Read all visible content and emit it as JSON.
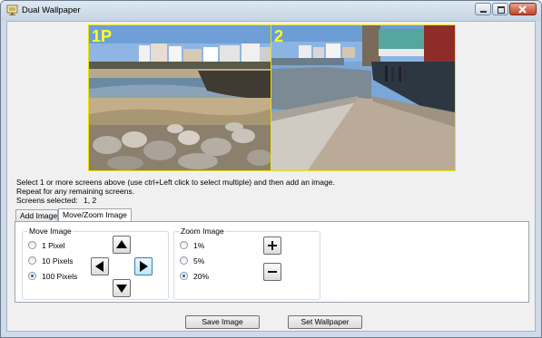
{
  "window": {
    "title": "Dual Wallpaper",
    "app_icon": "wallpaper-app-icon",
    "controls": [
      "minimize-icon",
      "maximize-icon",
      "close-icon"
    ]
  },
  "preview": {
    "screens": [
      {
        "label": "1P",
        "selected": true,
        "image": "beach-town-photo"
      },
      {
        "label": "2",
        "selected": true,
        "image": "promenade-seawall-photo"
      }
    ],
    "highlight_color": "#e8e400"
  },
  "instructions": {
    "line1": "Select 1 or more screens above (use ctrl+Left click to select multiple) and then add an image.",
    "line2": "Repeat for any remaining screens.",
    "selected_label": "Screens selected:",
    "selected_value": "1, 2"
  },
  "tabs": [
    {
      "label": "Add Image",
      "active": false
    },
    {
      "label": "Move/Zoom Image",
      "active": true
    }
  ],
  "move_group": {
    "label": "Move Image",
    "options": [
      {
        "label": "1 Pixel",
        "checked": false
      },
      {
        "label": "10 Pixels",
        "checked": false
      },
      {
        "label": "100 Pixels",
        "checked": true
      }
    ],
    "arrows": [
      "arrow-up-icon",
      "arrow-left-icon",
      "arrow-right-icon",
      "arrow-down-icon"
    ],
    "focused_arrow": "right"
  },
  "zoom_group": {
    "label": "Zoom Image",
    "options": [
      {
        "label": "1%",
        "checked": false
      },
      {
        "label": "5%",
        "checked": false
      },
      {
        "label": "20%",
        "checked": true
      }
    ],
    "buttons": [
      "plus-icon",
      "minus-icon"
    ]
  },
  "buttons": {
    "save": "Save Image",
    "set": "Set Wallpaper"
  }
}
